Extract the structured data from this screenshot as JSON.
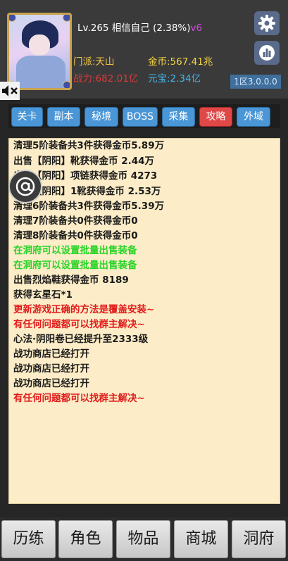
{
  "player": {
    "level_text": "Lv.265 相信自己",
    "exp_text": "(2.38%)",
    "vip_text": "v6",
    "sect_text": "门派:天山",
    "power_text": "战力:682.01亿",
    "gold_text": "金币:567.41兆",
    "yuanbao_text": "元宝:2.34亿"
  },
  "server": {
    "label": "1区3.0.0.0"
  },
  "icons": {
    "settings": "gear-icon",
    "stats": "bar-chart-icon",
    "mute": "speaker-muted-icon",
    "mention": "at-icon"
  },
  "tabs": [
    {
      "label": "关卡"
    },
    {
      "label": "副本"
    },
    {
      "label": "秘境"
    },
    {
      "label": "BOSS"
    },
    {
      "label": "采集"
    },
    {
      "label": "攻略",
      "active": true
    },
    {
      "label": "外域"
    }
  ],
  "log": [
    {
      "text": "清理5阶装备共3件获得金币5.89万",
      "color": "dark"
    },
    {
      "text": "出售【阴阳】靴获得金币  2.44万",
      "color": "dark"
    },
    {
      "text": "出售【阴阳】项链获得金币  4273",
      "color": "dark"
    },
    {
      "text": "出售【阴阳】1靴获得金币  2.53万",
      "color": "dark"
    },
    {
      "text": "清理6阶装备共3件获得金币5.39万",
      "color": "dark"
    },
    {
      "text": "清理7阶装备共0件获得金币0",
      "color": "dark"
    },
    {
      "text": "清理8阶装备共0件获得金币0",
      "color": "dark"
    },
    {
      "text": "在洞府可以设置批量出售装备",
      "color": "green"
    },
    {
      "text": "在洞府可以设置批量出售装备",
      "color": "green"
    },
    {
      "text": "出售烈焰鞋获得金币  8189",
      "color": "dark"
    },
    {
      "text": "获得玄星石*1",
      "color": "dark"
    },
    {
      "text": "更新游戏正确的方法是覆盖安装~",
      "color": "red"
    },
    {
      "text": "有任何问题都可以找群主解决~",
      "color": "red"
    },
    {
      "text": "心法·阴阳卷已经提升至2333级",
      "color": "dark"
    },
    {
      "text": "战功商店已经打开",
      "color": "dark"
    },
    {
      "text": "战功商店已经打开",
      "color": "dark"
    },
    {
      "text": "战功商店已经打开",
      "color": "dark"
    },
    {
      "text": "有任何问题都可以找群主解决~",
      "color": "red"
    }
  ],
  "bottom_nav": [
    {
      "label": "历练"
    },
    {
      "label": "角色"
    },
    {
      "label": "物品"
    },
    {
      "label": "商城"
    },
    {
      "label": "洞府"
    }
  ],
  "colors": {
    "tab_blue": "#4a96d6",
    "tab_active_red": "#e04848",
    "log_background": "#fcecc7",
    "gold_yellow": "#f5d442",
    "power_red": "#d93b3b",
    "yuanbao_blue": "#45b8f0",
    "vip_purple": "#d24fe0"
  }
}
